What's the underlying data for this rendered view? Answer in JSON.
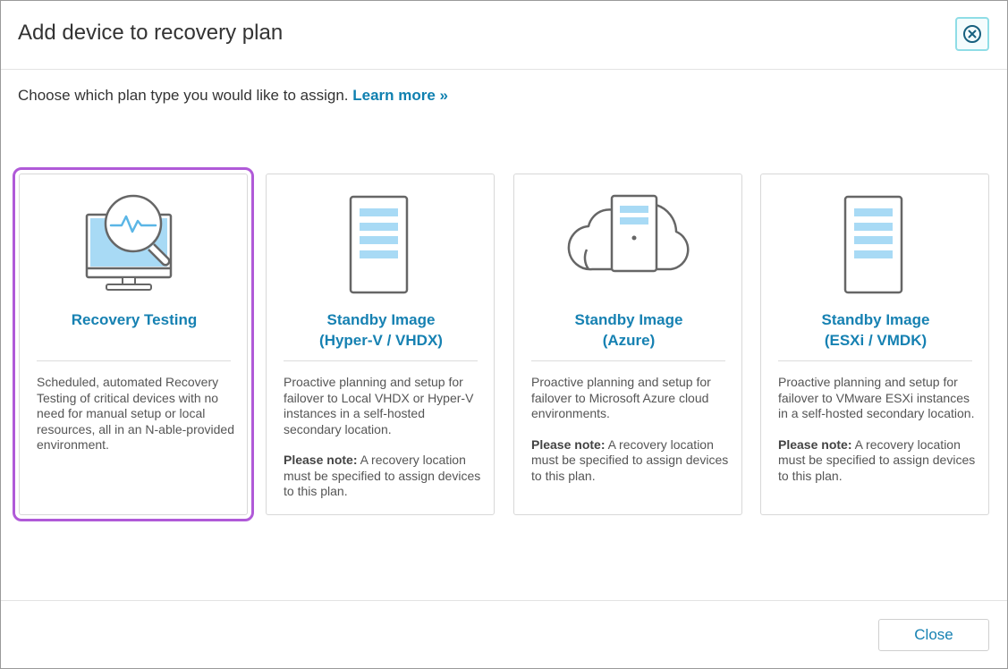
{
  "dialog": {
    "title": "Add device to recovery plan",
    "close_icon": "close-circle-icon"
  },
  "intro": {
    "text": "Choose which plan type you would like to assign.",
    "link": "Learn more »"
  },
  "cards": [
    {
      "icon": "monitor-magnifier-icon",
      "title_line1": "Recovery Testing",
      "title_line2": "",
      "description": "Scheduled, automated Recovery Testing of critical devices with no need for manual setup or local resources, all in an N-able-provided environment.",
      "note_label": "",
      "note_text": "",
      "selected": true
    },
    {
      "icon": "server-tower-icon",
      "title_line1": "Standby Image",
      "title_line2": "(Hyper-V / VHDX)",
      "description": "Proactive planning and setup for failover to Local VHDX or Hyper-V instances in a self-hosted secondary location.",
      "note_label": "Please note:",
      "note_text": " A recovery location must be specified to assign devices to this plan.",
      "selected": false
    },
    {
      "icon": "cloud-server-icon",
      "title_line1": "Standby Image",
      "title_line2": "(Azure)",
      "description": "Proactive planning and setup for failover to Microsoft Azure cloud environments.",
      "note_label": "Please note:",
      "note_text": " A recovery location must be specified to assign devices to this plan.",
      "selected": false
    },
    {
      "icon": "server-tower-icon",
      "title_line1": "Standby Image",
      "title_line2": "(ESXi / VMDK)",
      "description": "Proactive planning and setup for failover to VMware ESXi instances in a self-hosted secondary location.",
      "note_label": "Please note:",
      "note_text": " A recovery location must be specified to assign devices to this plan.",
      "selected": false
    }
  ],
  "footer": {
    "close_label": "Close"
  },
  "colors": {
    "accent": "#1681b2",
    "selected_outline": "#b05ad8",
    "icon_fill": "#a8daf5",
    "icon_stroke": "#666666"
  }
}
